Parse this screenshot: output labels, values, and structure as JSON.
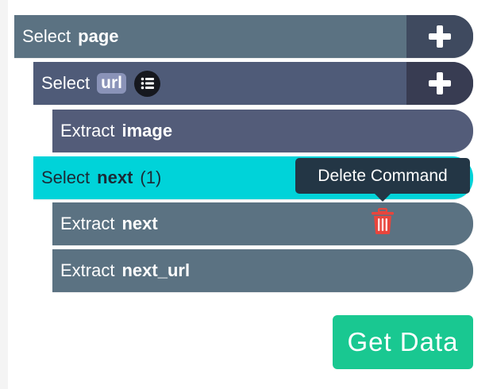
{
  "commands": [
    {
      "verb": "Select",
      "target": "page"
    },
    {
      "verb": "Select",
      "target": "url"
    },
    {
      "verb": "Extract",
      "target": "image"
    },
    {
      "verb": "Select",
      "target": "next",
      "count": "(1)"
    },
    {
      "verb": "Extract",
      "target": "next"
    },
    {
      "verb": "Extract",
      "target": "next_url"
    }
  ],
  "tooltip": {
    "text": "Delete Command"
  },
  "actions": {
    "get_data_label": "Get Data"
  },
  "icons": {
    "add": "plus-icon",
    "list": "list-icon",
    "delete": "trash-icon"
  },
  "colors": {
    "selected_command": "#00d3d9",
    "delete_icon": "#e8453c",
    "get_data_button": "#19c891",
    "tooltip_bg": "#233645"
  }
}
